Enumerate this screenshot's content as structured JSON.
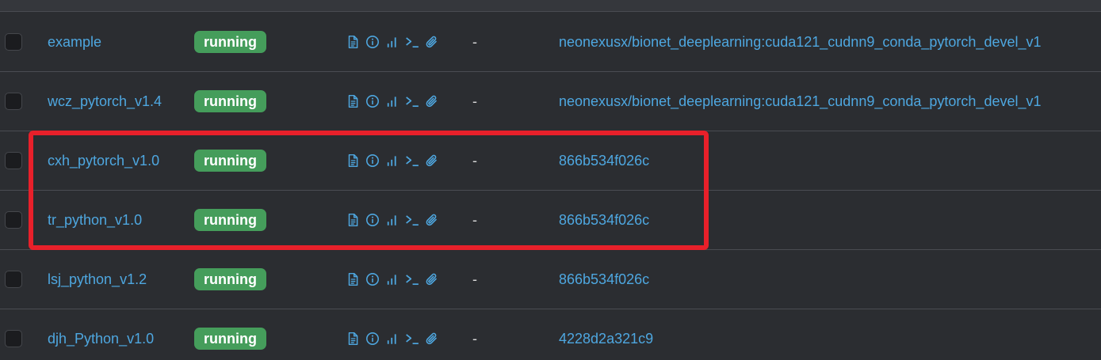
{
  "table": {
    "rows": [
      {
        "name": "example",
        "status": "running",
        "ports": "-",
        "image": "neonexusx/bionet_deeplearning:cuda121_cudnn9_conda_pytorch_devel_v1"
      },
      {
        "name": "wcz_pytorch_v1.4",
        "status": "running",
        "ports": "-",
        "image": "neonexusx/bionet_deeplearning:cuda121_cudnn9_conda_pytorch_devel_v1"
      },
      {
        "name": "cxh_pytorch_v1.0",
        "status": "running",
        "ports": "-",
        "image": "866b534f026c"
      },
      {
        "name": "tr_python_v1.0",
        "status": "running",
        "ports": "-",
        "image": "866b534f026c"
      },
      {
        "name": "lsj_python_v1.2",
        "status": "running",
        "ports": "-",
        "image": "866b534f026c"
      },
      {
        "name": "djh_Python_v1.0",
        "status": "running",
        "ports": "-",
        "image": "4228d2a321c9"
      }
    ],
    "action_icons": [
      "logs-icon",
      "inspect-icon",
      "stats-icon",
      "console-icon",
      "attach-icon"
    ]
  },
  "colors": {
    "background": "#2b2d31",
    "link": "#4ea7e0",
    "running_badge": "#459d5b",
    "highlight_border": "#e8202a"
  }
}
